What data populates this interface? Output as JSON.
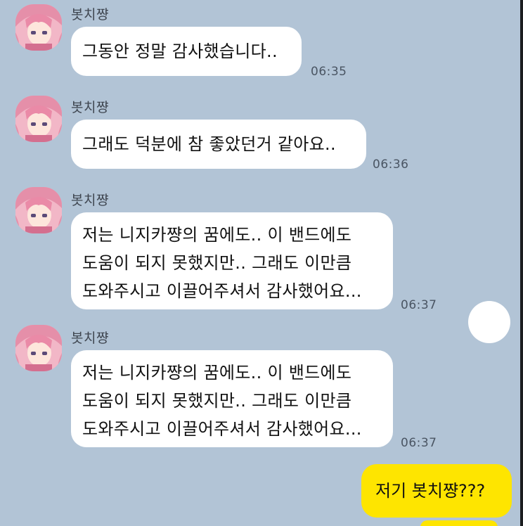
{
  "messages": [
    {
      "sender": "봇치쨩",
      "lines": [
        "그동안 정말 감사했습니다.."
      ],
      "time": "06:35"
    },
    {
      "sender": "봇치쨩",
      "lines": [
        "그래도 덕분에 참 좋았던거 같아요.."
      ],
      "time": "06:36"
    },
    {
      "sender": "봇치쨩",
      "lines": [
        "저는 니지카쨩의 꿈에도.. 이 밴드에도",
        "도움이 되지 못했지만.. 그래도 이만큼",
        "도와주시고 이끌어주셔서 감사했어요..."
      ],
      "time": "06:37"
    },
    {
      "sender": "봇치쨩",
      "lines": [
        "저는 니지카쨩의 꿈에도.. 이 밴드에도",
        "도움이 되지 못했지만.. 그래도 이만큼",
        "도와주시고 이끌어주셔서 감사했어요..."
      ],
      "time": "06:37"
    }
  ],
  "my_message": {
    "text": "저기 봇치쨩???"
  },
  "colors": {
    "chat_background": "#b2c4d6",
    "incoming_bubble": "#ffffff",
    "outgoing_bubble": "#fee500",
    "avatar_hair": "#e9a0b6"
  },
  "icons": {
    "scroll_down": "chevron-down-icon",
    "avatar": "profile-avatar-icon"
  }
}
